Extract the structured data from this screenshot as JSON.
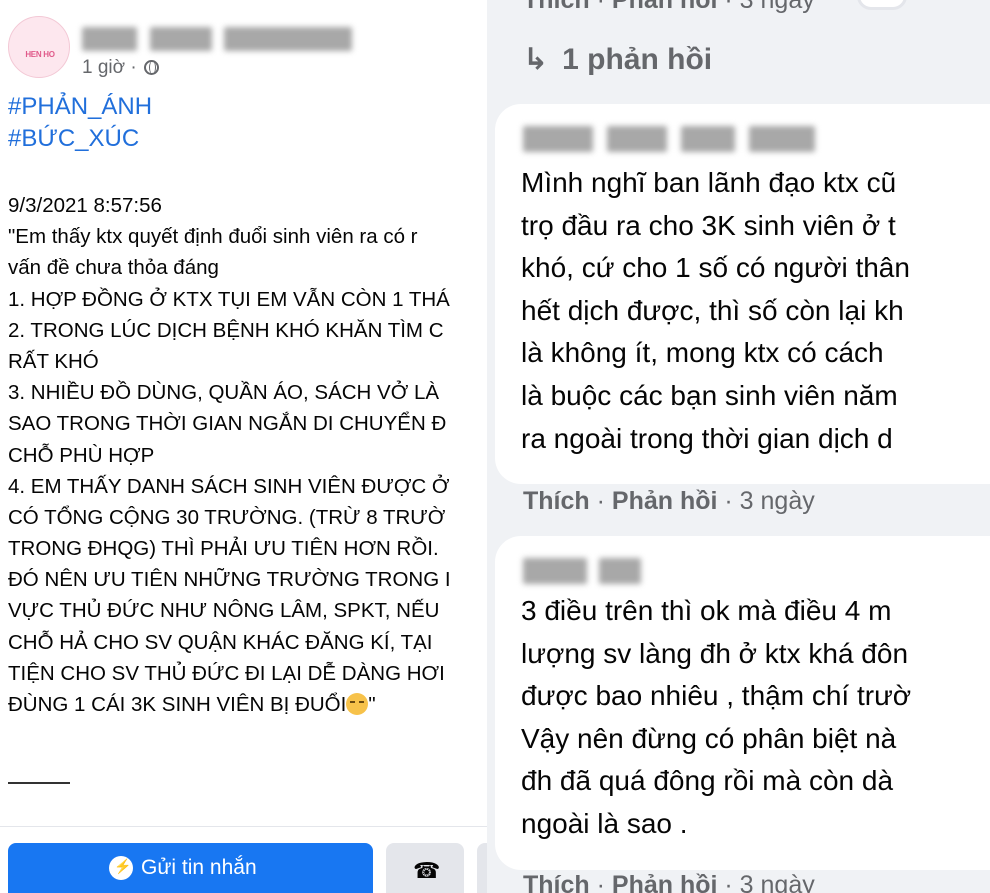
{
  "post": {
    "avatar_text": "HEN HO",
    "time": "1 giờ ·",
    "tags": [
      "#PHẢN_ÁNH",
      "#BỨC_XÚC"
    ],
    "body_lines": [
      "9/3/2021 8:57:56",
      "\"Em thấy ktx quyết định đuổi sinh viên ra có r",
      "vấn đề chưa thỏa đáng",
      "1. HỢP ĐỒNG Ở KTX TỤI EM VẪN CÒN 1 THÁ",
      "2. TRONG LÚC DỊCH BỆNH KHÓ KHĂN TÌM C",
      "RẤT KHÓ",
      "3. NHIỀU ĐỒ DÙNG, QUẦN ÁO, SÁCH VỞ LÀ",
      "SAO TRONG THỜI GIAN NGẮN DI CHUYỂN Đ",
      "CHỖ PHÙ HỢP",
      "4. EM THẤY DANH SÁCH SINH VIÊN ĐƯỢC Ở",
      "CÓ TỔNG CỘNG 30 TRƯỜNG. (TRỪ 8 TRƯỜ",
      "TRONG ĐHQG) THÌ PHẢI ƯU TIÊN HƠN RỒI.",
      "ĐÓ NÊN ƯU TIÊN NHỮNG TRƯỜNG TRONG I",
      "VỰC THỦ ĐỨC NHƯ NÔNG LÂM, SPKT, NẾU",
      "CHỖ HẢ CHO SV QUẬN KHÁC ĐĂNG KÍ, TẠI",
      "TIỆN CHO SV THỦ ĐỨC ĐI LẠI DỄ DÀNG HƠI",
      "ĐÙNG 1 CÁI 3K SINH VIÊN BỊ ĐUỔI"
    ],
    "body_end": "\"",
    "message_button": "Gửi tin nhắn"
  },
  "comments": {
    "top_actions": {
      "like": "Thích",
      "sep1": " · ",
      "reply": "Phản hồi",
      "time": " · 3 ngày"
    },
    "replies_label": "1 phản hồi",
    "items": [
      {
        "lines": [
          "Mình nghĩ ban lãnh đạo ktx cũ",
          "trọ đầu ra cho 3K sinh viên ở t",
          "khó, cứ cho 1 số có người thân",
          "hết dịch được, thì số còn lại kh",
          "là không ít, mong ktx có cách",
          "là buộc các bạn sinh viên năm",
          "ra ngoài trong thời gian dịch d"
        ],
        "actions": {
          "like": "Thích",
          "sep1": " · ",
          "reply": "Phản hồi",
          "time": " · 3 ngày"
        }
      },
      {
        "lines": [
          "3 điều trên thì ok mà điều 4 m",
          "lượng sv làng đh ở ktx khá đôn",
          "được bao nhiêu , thậm chí trườ",
          "Vậy nên đừng có phân biệt nà",
          "đh đã quá đông rồi mà còn dà",
          "ngoài là sao ."
        ],
        "actions": {
          "like": "Thích",
          "sep1": " · ",
          "reply": "Phản hồi",
          "time": " · 3 ngày"
        }
      }
    ]
  },
  "icons": [
    "globe-icon",
    "emoji-pensive-icon",
    "messenger-icon",
    "phone-icon",
    "reply-arrow-icon"
  ],
  "colors": {
    "link": "#216fdb",
    "primary_button": "#1877f2",
    "muted": "#65676b",
    "comment_bg": "#f0f2f5"
  }
}
